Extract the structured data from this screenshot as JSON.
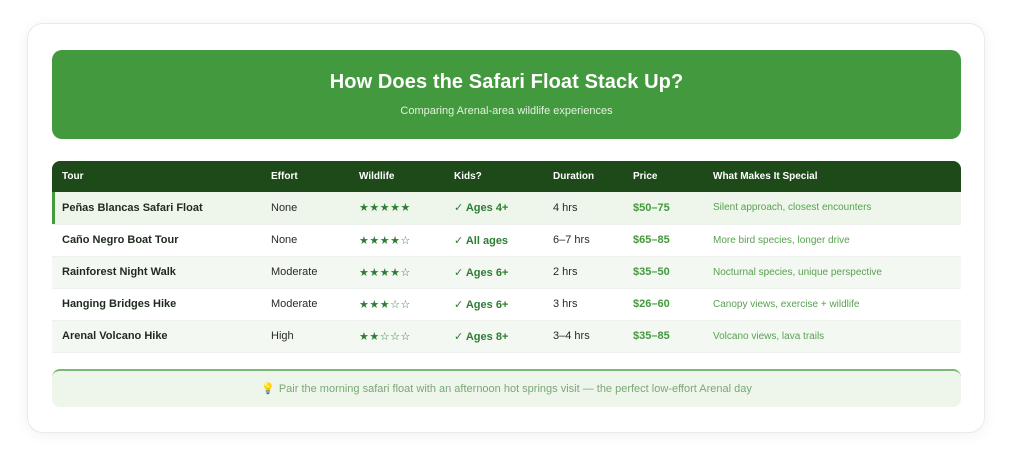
{
  "header": {
    "title": "How Does the Safari Float Stack Up?",
    "subtitle": "Comparing Arenal-area wildlife experiences"
  },
  "table": {
    "columns": [
      "Tour",
      "Effort",
      "Wildlife",
      "Kids?",
      "Duration",
      "Price",
      "What Makes It Special"
    ],
    "rows": [
      {
        "tour": "Peñas Blancas Safari Float",
        "effort": "None",
        "wildlife": "★★★★★",
        "kids": "✓ Ages 4+",
        "duration": "4 hrs",
        "price": "$50–75",
        "special": "Silent approach, closest encounters"
      },
      {
        "tour": "Caño Negro Boat Tour",
        "effort": "None",
        "wildlife": "★★★★☆",
        "kids": "✓ All ages",
        "duration": "6–7 hrs",
        "price": "$65–85",
        "special": "More bird species, longer drive"
      },
      {
        "tour": "Rainforest Night Walk",
        "effort": "Moderate",
        "wildlife": "★★★★☆",
        "kids": "✓ Ages 6+",
        "duration": "2 hrs",
        "price": "$35–50",
        "special": "Nocturnal species, unique perspective"
      },
      {
        "tour": "Hanging Bridges Hike",
        "effort": "Moderate",
        "wildlife": "★★★☆☆",
        "kids": "✓ Ages 6+",
        "duration": "3 hrs",
        "price": "$26–60",
        "special": "Canopy views, exercise + wildlife"
      },
      {
        "tour": "Arenal Volcano Hike",
        "effort": "High",
        "wildlife": "★★☆☆☆",
        "kids": "✓ Ages 8+",
        "duration": "3–4 hrs",
        "price": "$35–85",
        "special": "Volcano views, lava trails"
      }
    ]
  },
  "tip": {
    "icon": "lightbulb-icon",
    "text": "Pair the morning safari float with an afternoon hot springs visit — the perfect low-effort Arenal day"
  },
  "colors": {
    "header_green": "#43993d",
    "table_head": "#1e4a1a",
    "accent": "#2e7d32"
  }
}
